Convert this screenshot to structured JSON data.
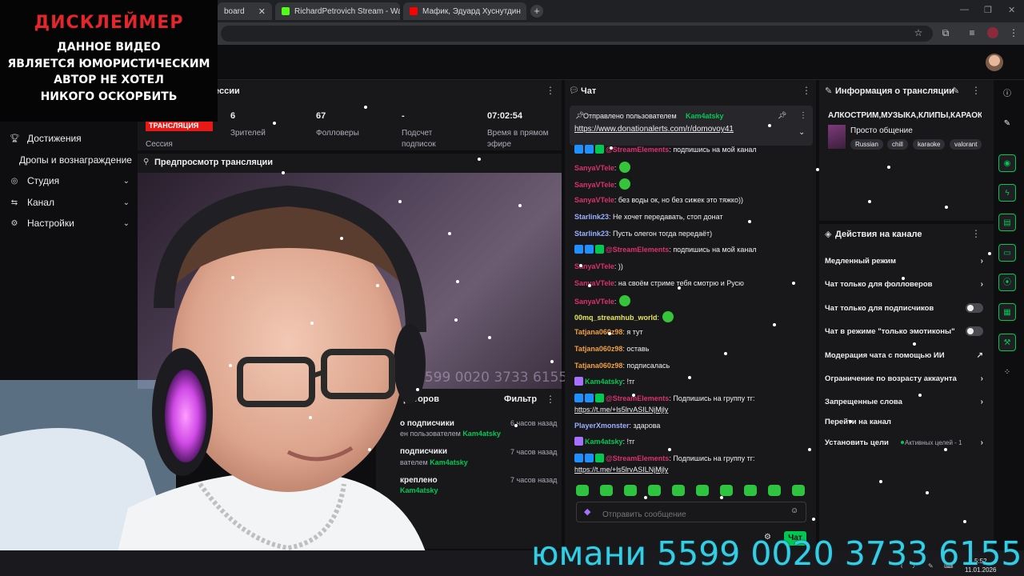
{
  "browser": {
    "tabs": [
      {
        "label": "board",
        "favicon_color": "#35363a"
      },
      {
        "label": "RichardPetrovich Stream - Wat",
        "favicon_color": "#53fc18"
      },
      {
        "label": "Мафик, Эдуард Хуснутдин",
        "favicon_color": "#ff0000"
      }
    ],
    "new_tab": "+"
  },
  "disclaimer": {
    "title": "ДИСКЛЕЙМЕР",
    "lines": [
      "ДАННОЕ ВИДЕО",
      "ЯВЛЯЕТСЯ ЮМОРИСТИЧЕСКИМ",
      "АВТОР НЕ ХОТЕЛ",
      "НИКОГО ОСКОРБИТЬ"
    ]
  },
  "nav": {
    "items": [
      {
        "label": "Достижения",
        "icon": "trophy-icon"
      },
      {
        "label": "Дропы и вознаграждение",
        "icon": ""
      },
      {
        "label": "Студия",
        "icon": "studio-icon"
      },
      {
        "label": "Канал",
        "icon": "channel-icon"
      },
      {
        "label": "Настройки",
        "icon": "gear-icon"
      }
    ]
  },
  "session": {
    "title": "ессии",
    "live_label": "ТРАНСЛЯЦИЯ",
    "session_label": "Сессия",
    "stats": [
      {
        "value": "6",
        "label": "Зрителей"
      },
      {
        "value": "67",
        "label": "Фолловеры"
      },
      {
        "value": "-",
        "label": "Подсчет подписок"
      },
      {
        "value": "07:02:54",
        "label": "Время в прямом эфире"
      }
    ]
  },
  "preview": {
    "title": "Предпросмотр трансляции",
    "inner_text": "5599 0020 3733 6155"
  },
  "activity": {
    "title": "раторов",
    "filter_label": "Фильтр",
    "items": [
      {
        "main": "о подписчики",
        "sub": "ен пользователем",
        "user": "Kam4atsky",
        "time": "6 часов назад"
      },
      {
        "main": "подписчики",
        "sub": "вателем",
        "user": "Kam4atsky",
        "time": "7 часов назад"
      },
      {
        "main": "креплено",
        "sub": "",
        "user": "Kam4atsky",
        "time": "7 часов назад"
      }
    ]
  },
  "chat": {
    "title": "Чат",
    "pinned": {
      "by": "Отправлено пользователем",
      "user": "Kam4atsky",
      "link": "https://www.donationalerts.com/r/domovoy41"
    },
    "messages": [
      {
        "name": "@StreamElements",
        "color": "#d9326e",
        "badges": [
          "#1e90ff",
          "#1e90ff",
          "#00c853"
        ],
        "text": ": подпишись на мой канал",
        "emote": false
      },
      {
        "name": "SanyaVTele",
        "color": "#d9326e",
        "badges": [],
        "text": ":",
        "emote": true
      },
      {
        "name": "SanyaVTele",
        "color": "#d9326e",
        "badges": [],
        "text": ":",
        "emote": true
      },
      {
        "name": "SanyaVTele",
        "color": "#d9326e",
        "badges": [],
        "text": ": без воды ок, но без сижек это тяжко))",
        "emote": false
      },
      {
        "name": "Starlink23",
        "color": "#9ab0ff",
        "badges": [],
        "text": ": Не хочет передавать, стоп донат",
        "emote": false
      },
      {
        "name": "Starlink23",
        "color": "#9ab0ff",
        "badges": [],
        "text": ": Пусть олегон тогда передаёт)",
        "emote": false
      },
      {
        "name": "@StreamElements",
        "color": "#d9326e",
        "badges": [
          "#1e90ff",
          "#1e90ff",
          "#00c853"
        ],
        "text": ": подпишись на мой канал",
        "emote": false
      },
      {
        "name": "SanyaVTele",
        "color": "#d9326e",
        "badges": [],
        "text": ": ))",
        "emote": false
      },
      {
        "name": "SanyaVTele",
        "color": "#d9326e",
        "badges": [],
        "text": ": на своём стриме тебя смотрю и Русю",
        "emote": false
      },
      {
        "name": "SanyaVTele",
        "color": "#d9326e",
        "badges": [],
        "text": ":",
        "emote": true
      },
      {
        "name": "00mq_streamhub_world",
        "color": "#e6e65c",
        "badges": [],
        "text": ":",
        "emote": true
      },
      {
        "name": "Tatjana060z98",
        "color": "#f0a040",
        "badges": [],
        "text": ": я тут",
        "emote": false
      },
      {
        "name": "Tatjana060z98",
        "color": "#f0a040",
        "badges": [],
        "text": ": оставь",
        "emote": false
      },
      {
        "name": "Tatjana060z98",
        "color": "#f0a040",
        "badges": [],
        "text": ": подписалась",
        "emote": false
      },
      {
        "name": "Kam4atsky",
        "color": "#00c853",
        "badges": [
          "#a970ff"
        ],
        "text": ": !тг",
        "emote": false
      },
      {
        "name": "@StreamElements",
        "color": "#d9326e",
        "badges": [
          "#1e90ff",
          "#1e90ff",
          "#00c853"
        ],
        "text": ": Подпишись на группу тг:",
        "emote": false
      },
      {
        "name": "",
        "color": "#efeff1",
        "badges": [],
        "text": "https://t.me/+ls5lrvASILNjMjly",
        "emote": false,
        "link": true
      },
      {
        "name": "PlayerXmonster",
        "color": "#9ab0ff",
        "badges": [],
        "text": ": здарова",
        "emote": false
      },
      {
        "name": "Kam4atsky",
        "color": "#00c853",
        "badges": [
          "#a970ff"
        ],
        "text": ": !тг",
        "emote": false
      },
      {
        "name": "@StreamElements",
        "color": "#d9326e",
        "badges": [
          "#1e90ff",
          "#1e90ff",
          "#00c853"
        ],
        "text": ": Подпишись на группу тг:",
        "emote": false
      },
      {
        "name": "",
        "color": "#efeff1",
        "badges": [],
        "text": "https://t.me/+ls5lrvASILNjMjly",
        "emote": false,
        "link": true
      }
    ],
    "input_placeholder": "Отправить сообщение",
    "send_label": "Чат"
  },
  "stream_info": {
    "title": "Информация о трансляции",
    "stream_title": "АЛКОСТРИМ,МУЗЫКА,КЛИПЫ,КАРАОК",
    "category": "Просто общение",
    "tags": [
      "Russian",
      "chill",
      "karaoke",
      "valorant"
    ]
  },
  "channel_actions": {
    "title": "Действия на канале",
    "rows": [
      {
        "label": "Медленный режим",
        "control": "chevron"
      },
      {
        "label": "Чат только для фолловеров",
        "control": "chevron"
      },
      {
        "label": "Чат только для подписчиков",
        "control": "toggle"
      },
      {
        "label": "Чат в режиме \"только эмотиконы\"",
        "control": "toggle"
      },
      {
        "label": "Модерация чата с помощью ИИ",
        "control": "external"
      },
      {
        "label": "Ограничение по возрасту аккаунта",
        "control": "chevron"
      },
      {
        "label": "Запрещенные слова",
        "control": "chevron"
      },
      {
        "label": "Перейти на канал",
        "control": "none"
      },
      {
        "label": "Установить цели",
        "control": "chevron"
      }
    ],
    "goals_status": "Активных целей - 1"
  },
  "donation_overlay": "юмани 5599 0020 3733 6155",
  "taskbar": {
    "date": "11.01.2026",
    "time": "5:52"
  }
}
